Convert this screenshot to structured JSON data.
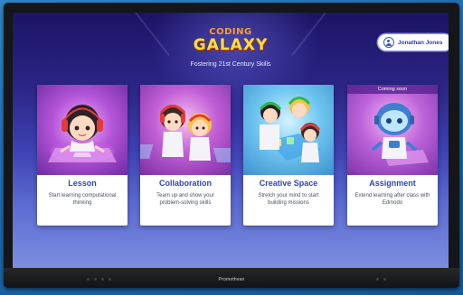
{
  "header": {
    "logo_top": "CODING",
    "logo_main": "GALAXY",
    "tagline": "Fostering 21st Century Skills"
  },
  "user": {
    "name": "Jonathan Jones",
    "icon": "user-circle-icon"
  },
  "cards": [
    {
      "title": "Lesson",
      "description": "Start learning computational thinking",
      "art": "lesson-character-art"
    },
    {
      "title": "Collaboration",
      "description": "Team up and show your problem-solving skills",
      "art": "collaboration-characters-art"
    },
    {
      "title": "Creative Space",
      "description": "Stretch your mind to start building missions",
      "art": "creative-space-characters-art"
    },
    {
      "title": "Assignment",
      "description": "Extend learning after class with Edmodo",
      "badge": "Coming soon",
      "art": "assignment-robot-art"
    }
  ],
  "device": {
    "brand": "Promethean"
  },
  "colors": {
    "accent": "#2c46b6",
    "logo_gold": "#ffdc3a",
    "logo_orange": "#ff9b2e"
  }
}
